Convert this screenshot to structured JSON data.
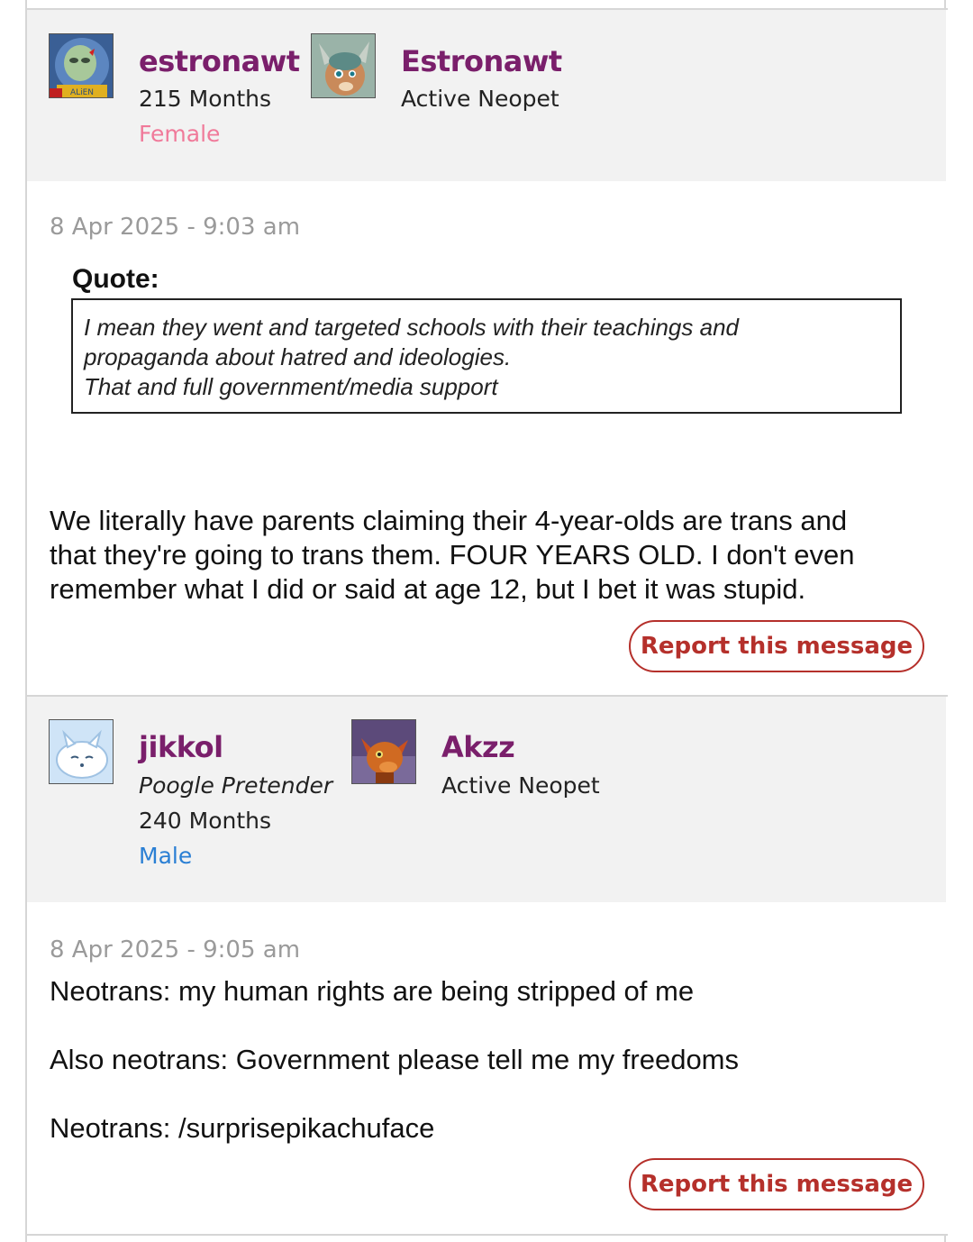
{
  "posts": [
    {
      "username": "estronawt",
      "user_title": "",
      "months": "215 Months",
      "gender": "Female",
      "pet_name": "Estronawt",
      "pet_status": "Active Neopet",
      "timestamp": "8 Apr 2025 - 9:03 am",
      "quote_label": "Quote:",
      "quote_lines": [
        "I mean they went and targeted schools with their teachings and",
        "propaganda about hatred and ideologies.",
        "That and full government/media support"
      ],
      "message_lines": [
        "We literally have parents claiming their 4-year-olds are trans and",
        "that they're going to trans them. FOUR YEARS OLD. I don't even",
        "remember what I did or said at age 12, but I bet it was stupid."
      ],
      "report_label": "Report this message"
    },
    {
      "username": "jikkol",
      "user_title": "Poogle Pretender",
      "months": "240 Months",
      "gender": "Male",
      "pet_name": "Akzz",
      "pet_status": "Active Neopet",
      "timestamp": "8 Apr 2025 - 9:05 am",
      "message_lines": [
        "Neotrans: my human rights are being stripped of me",
        "Also neotrans: Government please tell me my freedoms",
        "Neotrans: /surprisepikachuface"
      ],
      "report_label": "Report this message"
    }
  ],
  "colors": {
    "username": "#7a1f6b",
    "female": "#f07a9a",
    "male": "#2a7fd4",
    "report": "#b5302b",
    "header_bg": "#f2f2f2"
  }
}
